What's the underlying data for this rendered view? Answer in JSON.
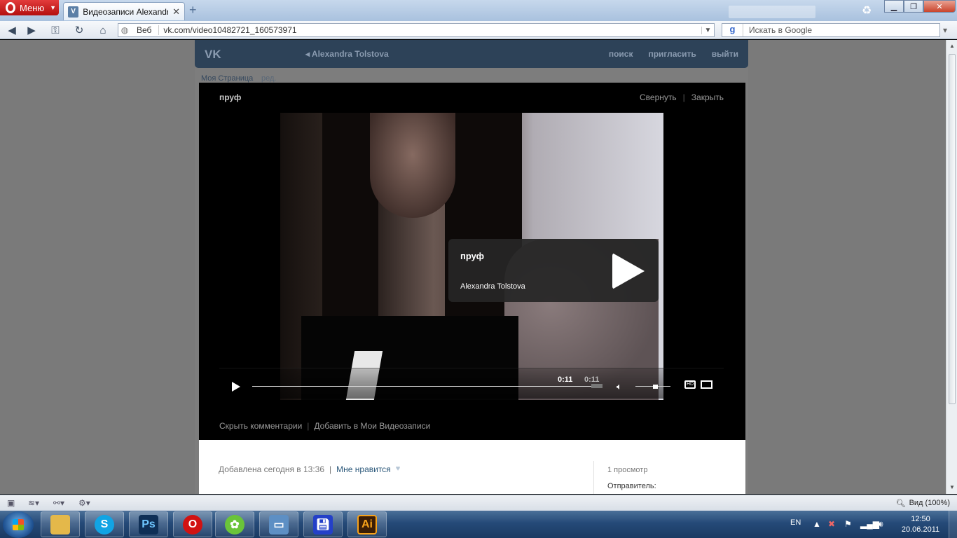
{
  "browser": {
    "menu_label": "Меню",
    "tab_title": "Видеозаписи Alexandr...",
    "tab_close": "✕",
    "new_tab": "+",
    "search_engine_label": "Веб",
    "url": "vk.com/video10482721_160573971",
    "search_placeholder": "Искать в Google",
    "zoom_label": "Вид (100%)"
  },
  "vk": {
    "logo": "VK",
    "back_label": "Alexandra Tolstova",
    "nav": [
      "поиск",
      "пригласить",
      "выйти"
    ],
    "my_page": "Моя Страница",
    "edit": "ред."
  },
  "video": {
    "title": "пруф",
    "actions": [
      "Свернуть",
      "Закрыть"
    ],
    "overlay_title": "пруф",
    "overlay_author": "Alexandra Tolstova",
    "time_current": "0:11",
    "time_total": "0:11",
    "progress_fraction": 1.0,
    "volume_fraction": 0.6,
    "bottom_links": [
      "Скрыть комментарии",
      "Добавить в Мои Видеозаписи"
    ]
  },
  "info": {
    "added": "Добавлена сегодня в 13:36",
    "like": "Мне нравится",
    "views": "1 просмотр",
    "sender": "Отправитель:"
  },
  "taskbar": {
    "lang": "EN",
    "time": "12:50",
    "date": "20.06.2011",
    "apps": [
      "explorer",
      "skype",
      "photoshop",
      "opera",
      "icq",
      "image-viewer",
      "save-disk",
      "illustrator"
    ]
  },
  "colors": {
    "vk_header": "#2d4258",
    "link": "#2b587a",
    "opera_red": "#c41a1a"
  }
}
